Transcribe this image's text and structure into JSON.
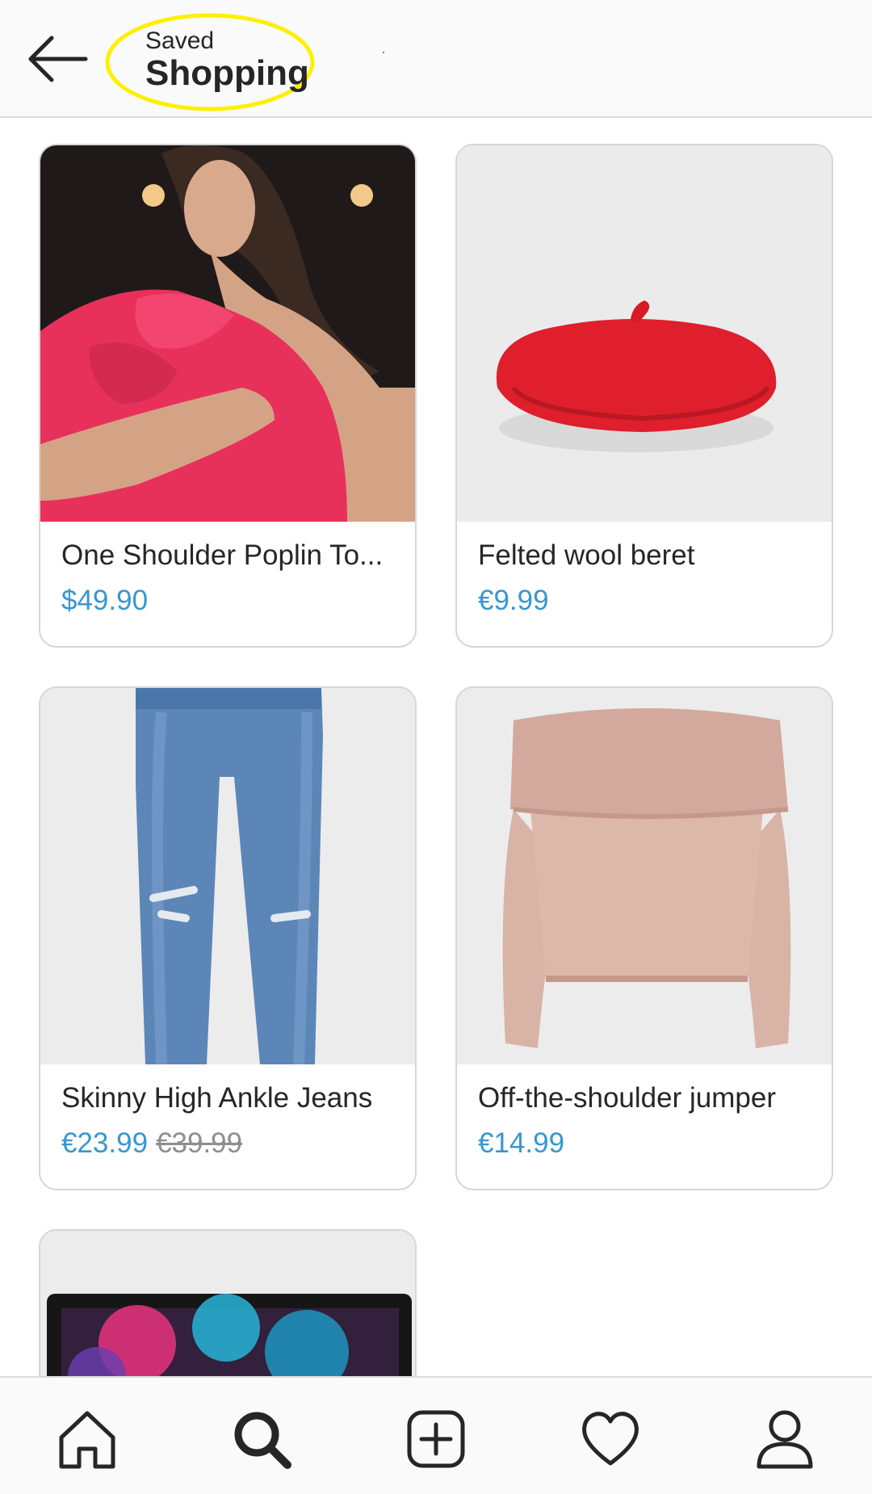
{
  "header": {
    "kicker": "Saved",
    "title": "Shopping"
  },
  "products": [
    {
      "name": "One Shoulder Poplin To...",
      "price": "$49.90"
    },
    {
      "name": "Felted wool beret",
      "price": "€9.99"
    },
    {
      "name": "Skinny High Ankle Jeans",
      "price": "€23.99",
      "old_price": "€39.99"
    },
    {
      "name": "Off-the-shoulder jumper",
      "price": "€14.99"
    }
  ],
  "colors": {
    "price": "#3897d0",
    "highlight": "#ffef00",
    "divider": "#dbdbdb"
  },
  "icons": [
    "back-arrow-icon",
    "home-icon",
    "search-icon",
    "add-post-icon",
    "heart-icon",
    "profile-icon"
  ]
}
